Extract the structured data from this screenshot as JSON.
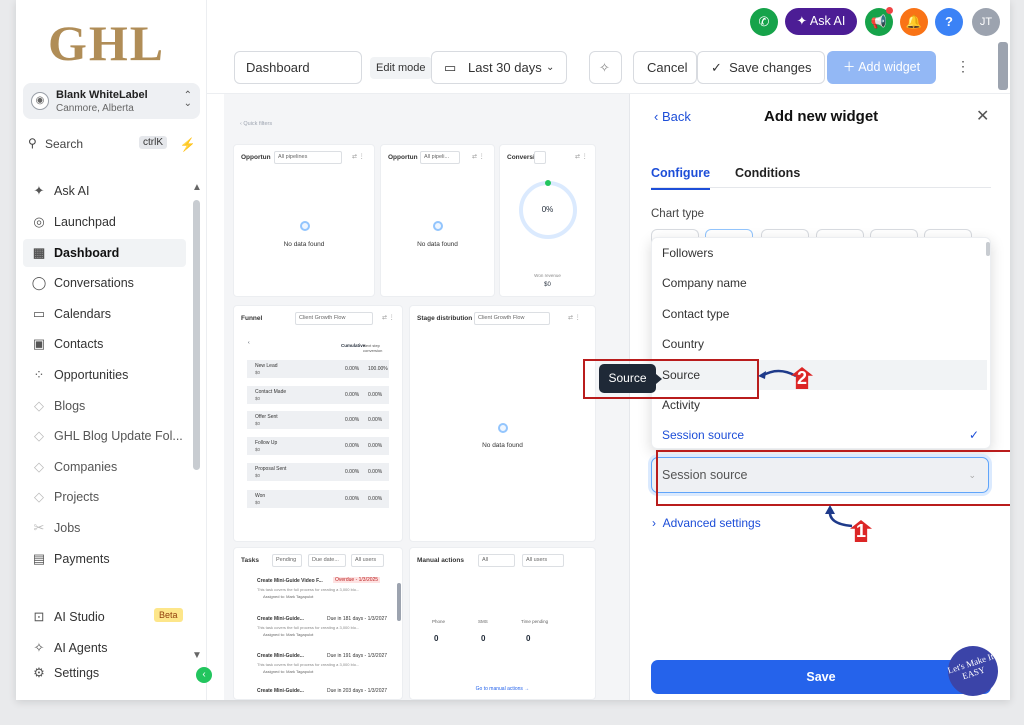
{
  "logo": "GHL",
  "location": {
    "name": "Blank WhiteLabel",
    "city": "Canmore, Alberta"
  },
  "search": {
    "label": "Search",
    "shortcut": "ctrlK"
  },
  "nav": [
    {
      "label": "Ask AI",
      "icon": "sparkle-icon"
    },
    {
      "label": "Launchpad",
      "icon": "rocket-icon"
    },
    {
      "label": "Dashboard",
      "icon": "grid-icon"
    },
    {
      "label": "Conversations",
      "icon": "chat-icon"
    },
    {
      "label": "Calendars",
      "icon": "calendar-icon"
    },
    {
      "label": "Contacts",
      "icon": "contacts-icon"
    },
    {
      "label": "Opportunities",
      "icon": "opportunities-icon"
    },
    {
      "label": "Blogs",
      "icon": "cube-icon"
    },
    {
      "label": "GHL Blog Update Fol...",
      "icon": "cube-icon"
    },
    {
      "label": "Companies",
      "icon": "cube-icon"
    },
    {
      "label": "Projects",
      "icon": "cube-icon"
    },
    {
      "label": "Jobs",
      "icon": "cube-icon"
    },
    {
      "label": "Payments",
      "icon": "receipt-icon"
    }
  ],
  "bottom_nav": [
    {
      "label": "AI Studio",
      "badge": "Beta"
    },
    {
      "label": "AI Agents"
    },
    {
      "label": "Settings"
    }
  ],
  "topbar": {
    "ask_ai": "Ask AI",
    "avatar": "JT",
    "help": "?"
  },
  "toolbar": {
    "dashboard_name": "Dashboard",
    "edit_mode": "Edit mode",
    "date_range": "Last 30 days",
    "cancel": "Cancel",
    "save_changes": "Save changes",
    "add_widget": "Add widget"
  },
  "canvas": {
    "quick_filters": "‹ Quick filters",
    "card1": {
      "title": "Opportun",
      "select": "All pipelines",
      "empty": "No data found"
    },
    "card2": {
      "title": "Opportun",
      "select": "All pipeli...",
      "empty": "No data found"
    },
    "card3": {
      "title": "Conversi",
      "value": "0%",
      "sub": "Won revenue",
      "sub_value": "$0"
    },
    "funnel": {
      "title": "Funnel",
      "select": "Client Growth Flow",
      "col1": "Cumulative",
      "col2": "Next step conversion",
      "rows": [
        {
          "name": "New Lead",
          "amount": "$0",
          "p1": "0.00%",
          "p2": "100.00%"
        },
        {
          "name": "Contact Made",
          "amount": "$0",
          "p1": "0.00%",
          "p2": "0.00%"
        },
        {
          "name": "Offer Sent",
          "amount": "$0",
          "p1": "0.00%",
          "p2": "0.00%"
        },
        {
          "name": "Follow Up",
          "amount": "$0",
          "p1": "0.00%",
          "p2": "0.00%"
        },
        {
          "name": "Proposal Sent",
          "amount": "$0",
          "p1": "0.00%",
          "p2": "0.00%"
        },
        {
          "name": "Won",
          "amount": "$0",
          "p1": "0.00%",
          "p2": "0.00%"
        }
      ]
    },
    "stage": {
      "title": "Stage distribution",
      "select": "Client Growth Flow",
      "empty": "No data found"
    },
    "tasks": {
      "title": "Tasks",
      "f1": "Pending",
      "f2": "Due date...",
      "f3": "All users",
      "items": [
        {
          "title": "Create Mini-Guide Video F...",
          "due": "Overdue - 1/3/2025",
          "desc": "This task covers the full process for creating a 3,000 blo...",
          "assigned": "Assigned to: Mark Tagapulot"
        },
        {
          "title": "Create Mini-Guide...",
          "due": "Due in 181 days - 1/3/2027",
          "desc": "This task covers the full process for creating a 3,000 blo...",
          "assigned": "Assigned to: Mark Tagapulot"
        },
        {
          "title": "Create Mini-Guide...",
          "due": "Due in 191 days - 1/3/2027",
          "desc": "This task covers the full process for creating a 3,000 blo...",
          "assigned": "Assigned to: Mark Tagapulot"
        },
        {
          "title": "Create Mini-Guide...",
          "due": "Due in 203 days - 1/3/2027",
          "desc": "This task covers the full process for creating a 3,000 blo...",
          "assigned": ""
        }
      ]
    },
    "manual": {
      "title": "Manual actions",
      "f1": "All",
      "f2": "All users",
      "labels": [
        "Phone",
        "SMS",
        "Time pending"
      ],
      "values": [
        "0",
        "0",
        "0"
      ],
      "link": "Go to manual actions →"
    }
  },
  "panel": {
    "back": "Back",
    "title": "Add new widget",
    "tab_configure": "Configure",
    "tab_conditions": "Conditions",
    "chart_type": "Chart type",
    "options": [
      "Followers",
      "Company name",
      "Contact type",
      "Country",
      "Source",
      "Activity",
      "Session source"
    ],
    "selected_value": "Session source",
    "advanced": "Advanced settings",
    "save": "Save"
  },
  "annotations": {
    "tooltip": "Source",
    "marker1": "1",
    "marker2": "2",
    "watermark": "Let's Make It EASY"
  },
  "colors": {
    "accent": "#2563eb",
    "annotation_red": "#b91c1c",
    "ask_ai": "#4c1d95"
  }
}
